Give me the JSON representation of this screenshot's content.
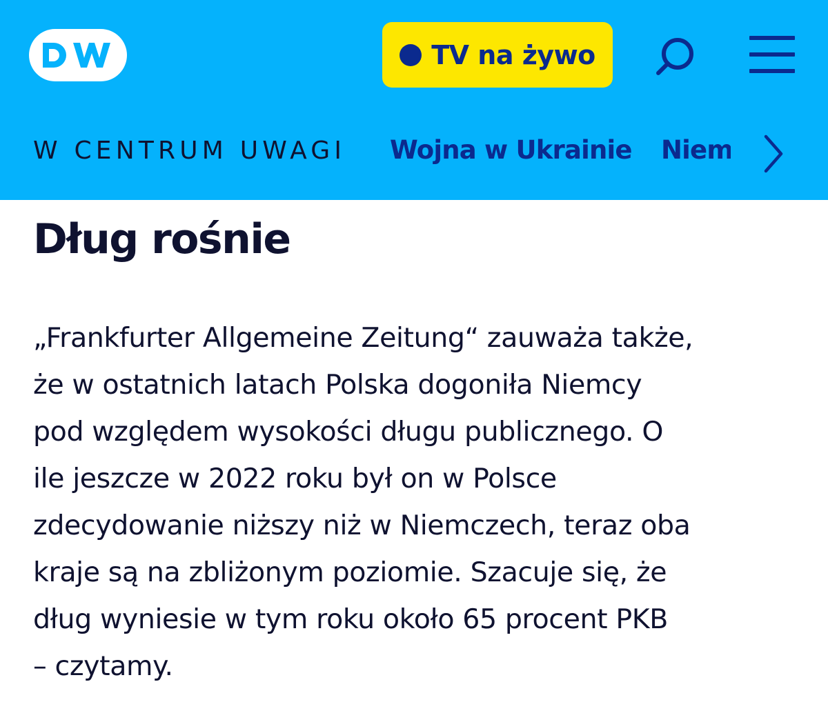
{
  "header": {
    "logo_text": "DW",
    "live_button_label": "TV na żywo",
    "search_icon": "search-icon",
    "menu_icon": "hamburger-menu-icon",
    "colors": {
      "background": "#05b2fc",
      "live_button": "#fde700",
      "accent": "#0b2a8e"
    }
  },
  "nav": {
    "spotlight_label": "W CENTRUM UWAGI",
    "links": [
      "Wojna w Ukrainie",
      "Niemcy"
    ],
    "next_icon": "chevron-right-icon"
  },
  "article": {
    "section_title": "Dług rośnie",
    "paragraph_lines": [
      "„Frankfurter Allgemeine Zeitung“ zauważa także,",
      "że w ostatnich latach Polska dogoniła Niemcy",
      "pod względem wysokości długu publicznego. O",
      "ile jeszcze w 2022 roku był on w Polsce",
      "zdecydowanie niższy niż w Niemczech, teraz oba",
      "kraje są na zbliżonym poziomie. Szacuje się, że",
      "dług wyniesie w tym roku około 65 procent PKB",
      "– czytamy."
    ]
  }
}
